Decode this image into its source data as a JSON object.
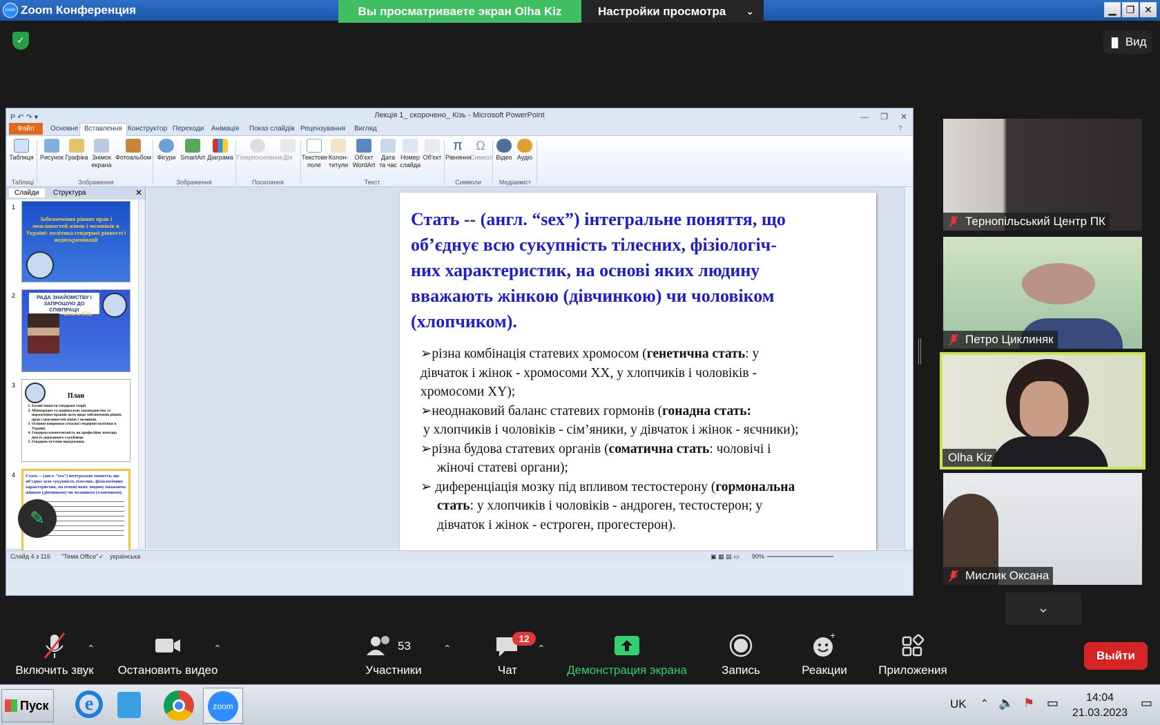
{
  "zoom": {
    "window_title": "Zoom Конференция",
    "share_banner": "Вы просматриваете экран Olha Kiz",
    "view_options": "Настройки просмотра",
    "view_button": "Вид",
    "toolbar": {
      "audio": "Включить звук",
      "video": "Остановить видео",
      "participants": "Участники",
      "participants_count": "53",
      "chat": "Чат",
      "chat_badge": "12",
      "share": "Демонстрация экрана",
      "record": "Запись",
      "reactions": "Реакции",
      "apps": "Приложения",
      "leave": "Выйти"
    },
    "participants": [
      {
        "name": "Тернопільський Центр ПК",
        "muted": true
      },
      {
        "name": "Петро Циклиняк",
        "muted": true
      },
      {
        "name": "Olha Kiz",
        "muted": false,
        "active": true
      },
      {
        "name": "Мислик Оксана",
        "muted": true
      }
    ],
    "accent_green": "#3fbf62",
    "leave_red": "#d62424"
  },
  "ppt": {
    "title": "Лекція 1_ скорочено_ Кізь  -  Microsoft PowerPoint",
    "tabs": [
      "Файл",
      "Основне",
      "Вставлення",
      "Конструктор",
      "Переходи",
      "Анімація",
      "Показ слайдів",
      "Рецензування",
      "Вигляд"
    ],
    "ribbon": {
      "b1": "Таблиця",
      "b2": "Рисунок",
      "b3": "Графіка",
      "b4": "Знімок екрана",
      "b5": "Фотоальбом",
      "b6": "Фігури",
      "b7": "SmartArt",
      "b8": "Діаграма",
      "b9": "Гіперпосилання",
      "b10": "Дія",
      "b11": "Текстове поле",
      "b12": "Колон-титули",
      "b13": "Об'єкт WordArt",
      "b14": "Дата та час",
      "b15": "Номер слайда",
      "b16": "Об'єкт",
      "b17": "Рівняння",
      "b18": "Символ",
      "b19": "Відео",
      "b20": "Аудіо",
      "g1": "Таблиці",
      "g2": "Зображення",
      "g3": "Зображення",
      "g4": "Посилання",
      "g5": "Текст",
      "g6": "Символи",
      "g7": "Медіавміст"
    },
    "panel_tabs": [
      "Слайди",
      "Структура"
    ],
    "thumbs": [
      {
        "num": "1",
        "title": "Забезпечення рівних прав і можливостей жінок і чоловіків в Україні: політика гендерної рівності і недискримінації"
      },
      {
        "num": "2",
        "title": "РАДА ЗНАЙОМСТВУ І ЗАПРОШУЮ ДО СПІВПРАЦІ!",
        "name": "Ольга Кізь"
      },
      {
        "num": "3",
        "title": "План",
        "items": [
          "Базові поняття гендерної теорії.",
          "Міжнародне та національне законодавство та нормативно-правові акти щодо забезпечення рівних прав і можливостей жінок і чоловіків.",
          "Основні напрямки сучасної гендерної політики в Україні.",
          "Гендерна компетентність як професійно значуща якість державного службовця.",
          "Гендерно чутливе врядування."
        ]
      },
      {
        "num": "4",
        "title": "Стать -- (англ. “sex”) інтегральне поняття, що об’єднує всю сукупність тілесних, фізіологічних характеристик, на основі яких людину вважають жінкою (дівчинкою) чи чоловіком (хлопчиком)."
      }
    ],
    "slide": {
      "title_l1": "Стать --  (англ. “sex”) інтегральне поняття, що",
      "title_l2": "об’єднує всю  сукупність тілесних, фізіологіч-",
      "title_l3": "них характеристик, на  основі яких людину",
      "title_l4": "вважають  жінкою (дівчинкою) чи чоловіком",
      "title_l5": "(хлопчиком).",
      "p1a": "➢різна комбінація статевих хромосом (",
      "p1b": "генетична  стать",
      "p1c": ": у",
      "p1d": "дівчаток і жінок - хромосоми ХХ, у  хлопчиків і чоловіків  -",
      "p1e": "хромосоми ХY);",
      "p2a": "➢неоднаковий баланс статевих гормонів (",
      "p2b": "гонадна стать:",
      "p2c": " у хлопчиків і чоловіків - сім’яники, у дівчаток і жінок - яєчники);",
      "p3a": "➢різна будова статевих органів (",
      "p3b": "соматична стать",
      "p3c": ": чоловічі і",
      "p3d": "жіночі статеві органи);",
      "p4a": "➢  диференціація мозку під впливом тестостерону (",
      "p4b": "гормональна",
      "p4c": "стать",
      "p4d": ": у хлопчиків і чоловіків - андроген, тестостерон; у",
      "p4e": "дівчаток і жінок - естроген, прогестерон)."
    },
    "status": {
      "slide": "Слайд 4 з 116",
      "theme": "\"Тема Office\"",
      "lang": "українська",
      "zoom": "90%"
    }
  },
  "taskbar": {
    "start": "Пуск",
    "lang": "UK",
    "time": "14:04",
    "date": "21.03.2023"
  }
}
